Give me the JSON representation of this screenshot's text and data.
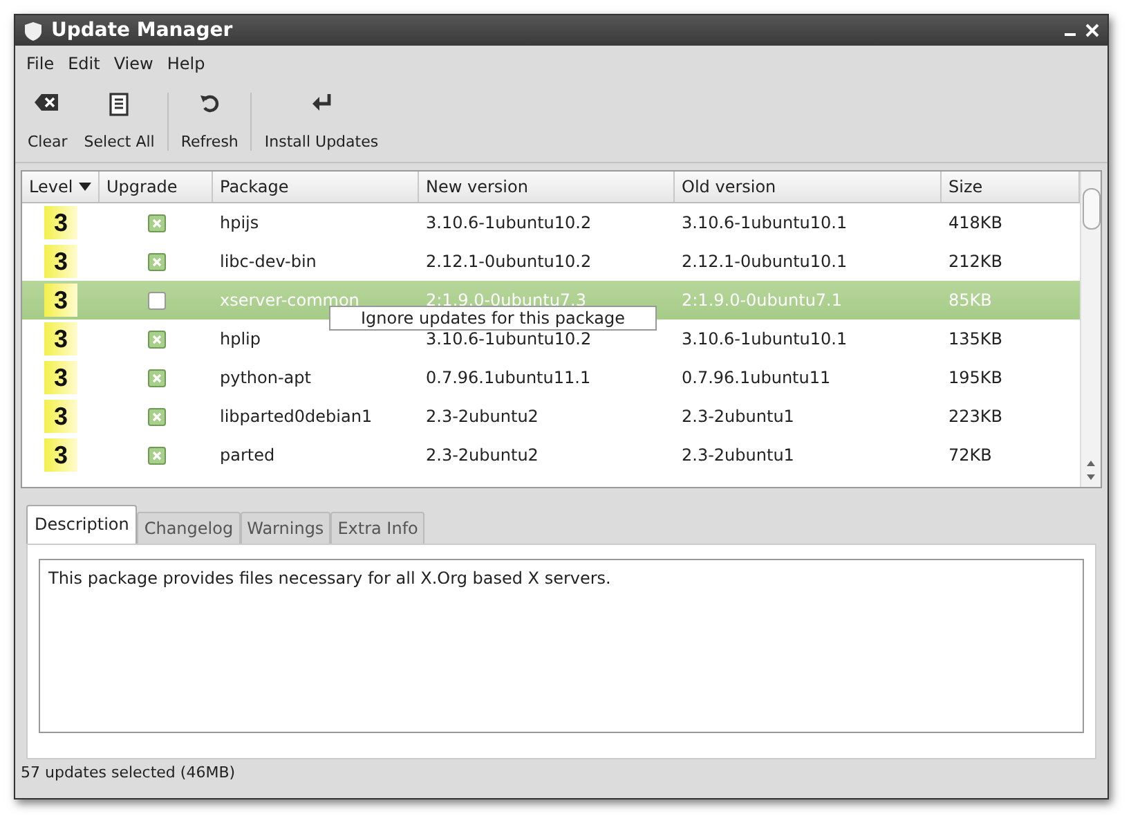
{
  "window": {
    "title": "Update Manager"
  },
  "menu": [
    "File",
    "Edit",
    "View",
    "Help"
  ],
  "toolbar": [
    {
      "kind": "clear",
      "label": "Clear"
    },
    {
      "kind": "select",
      "label": "Select All"
    },
    {
      "kind": "separator"
    },
    {
      "kind": "refresh",
      "label": "Refresh"
    },
    {
      "kind": "separator"
    },
    {
      "kind": "install",
      "label": "Install Updates"
    }
  ],
  "table": {
    "columns": [
      {
        "label": "Level",
        "sorted": true
      },
      {
        "label": "Upgrade",
        "sorted": false
      },
      {
        "label": "Package",
        "sorted": false
      },
      {
        "label": "New version",
        "sorted": false
      },
      {
        "label": "Old version",
        "sorted": false
      },
      {
        "label": "Size",
        "sorted": false
      }
    ],
    "rows": [
      {
        "level": "3",
        "upgrade": true,
        "package": "hpijs",
        "new_version": "3.10.6-1ubuntu10.2",
        "old_version": "3.10.6-1ubuntu10.1",
        "size": "418KB",
        "selected": false
      },
      {
        "level": "3",
        "upgrade": true,
        "package": "libc-dev-bin",
        "new_version": "2.12.1-0ubuntu10.2",
        "old_version": "2.12.1-0ubuntu10.1",
        "size": "212KB",
        "selected": false
      },
      {
        "level": "3",
        "upgrade": false,
        "package": "xserver-common",
        "new_version": "2:1.9.0-0ubuntu7.3",
        "old_version": "2:1.9.0-0ubuntu7.1",
        "size": "85KB",
        "selected": true
      },
      {
        "level": "3",
        "upgrade": true,
        "package": "hplip",
        "new_version": "3.10.6-1ubuntu10.2",
        "old_version": "3.10.6-1ubuntu10.1",
        "size": "135KB",
        "selected": false
      },
      {
        "level": "3",
        "upgrade": true,
        "package": "python-apt",
        "new_version": "0.7.96.1ubuntu11.1",
        "old_version": "0.7.96.1ubuntu11",
        "size": "195KB",
        "selected": false
      },
      {
        "level": "3",
        "upgrade": true,
        "package": "libparted0debian1",
        "new_version": "2.3-2ubuntu2",
        "old_version": "2.3-2ubuntu1",
        "size": "223KB",
        "selected": false
      },
      {
        "level": "3",
        "upgrade": true,
        "package": "parted",
        "new_version": "2.3-2ubuntu2",
        "old_version": "2.3-2ubuntu1",
        "size": "72KB",
        "selected": false
      }
    ]
  },
  "tooltip": "Ignore updates for this package",
  "tabs": [
    {
      "label": "Description",
      "selected": true
    },
    {
      "label": "Changelog",
      "selected": false
    },
    {
      "label": "Warnings",
      "selected": false
    },
    {
      "label": "Extra Info",
      "selected": false
    }
  ],
  "description": "This package provides files necessary for all X.Org based X servers.",
  "status_bar": "57 updates selected (46MB)"
}
